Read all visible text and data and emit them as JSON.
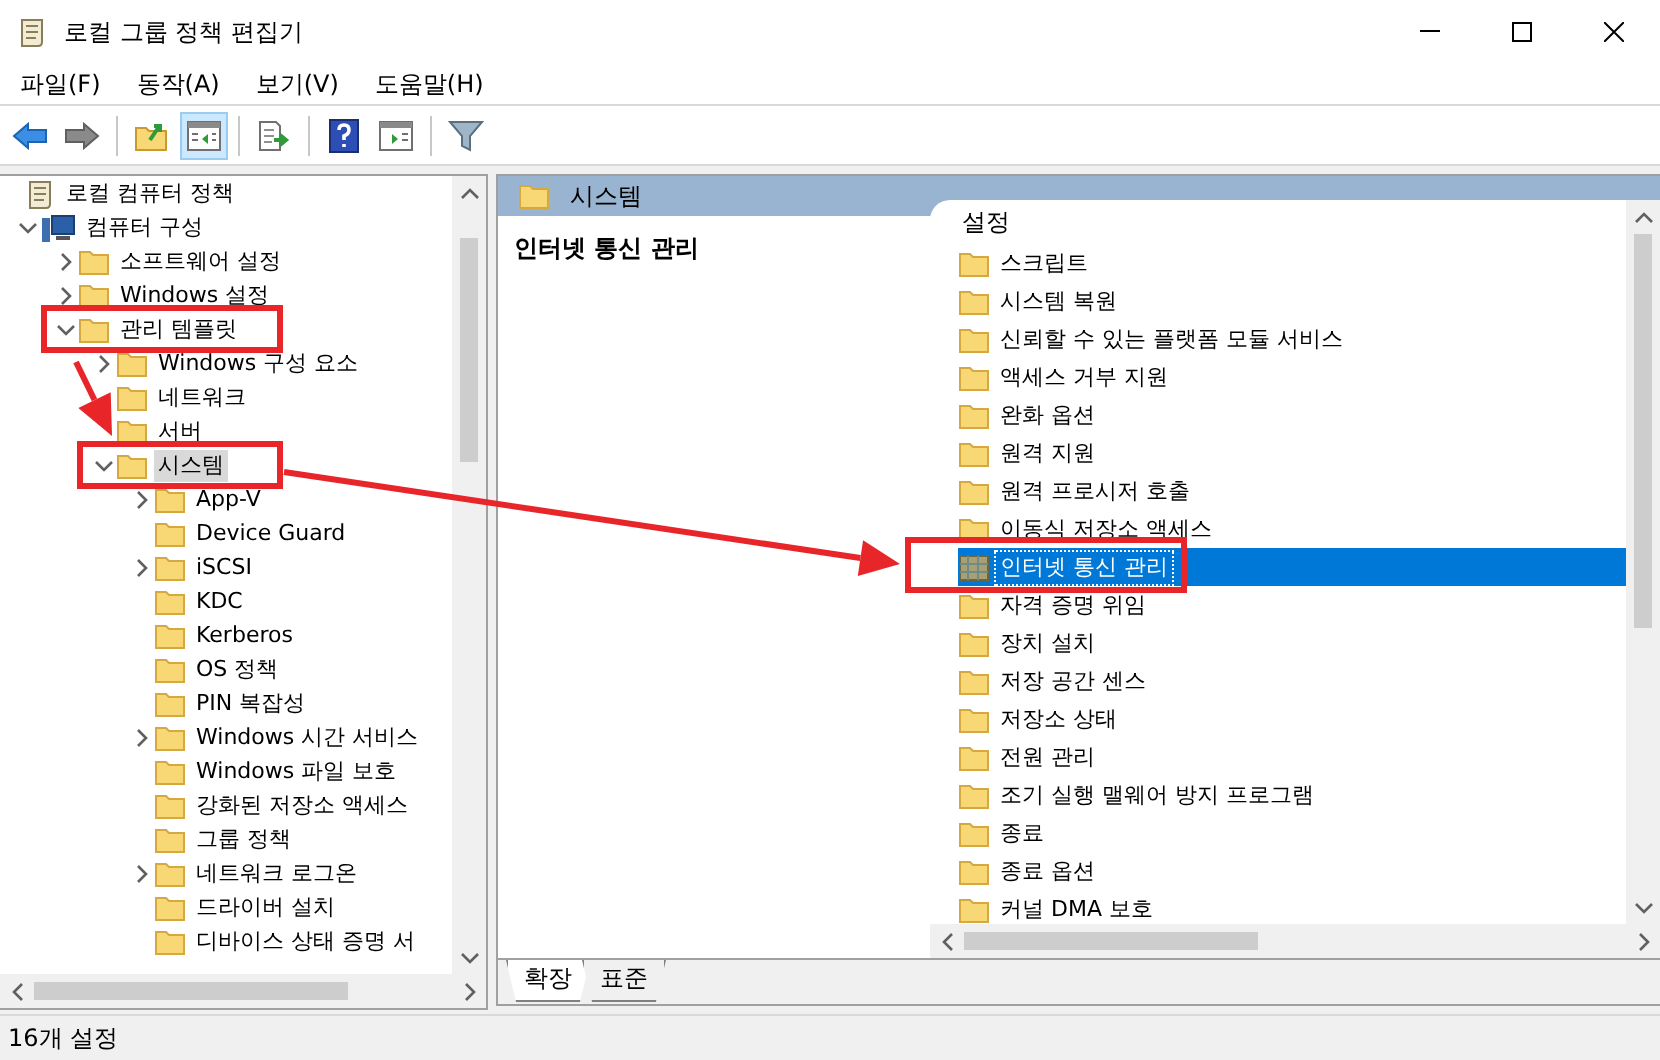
{
  "window": {
    "title": "로컬 그룹 정책 편집기"
  },
  "menu": [
    {
      "label": "파일(F)"
    },
    {
      "label": "동작(A)"
    },
    {
      "label": "보기(V)"
    },
    {
      "label": "도움말(H)"
    }
  ],
  "toolbar": [
    {
      "kind": "back",
      "selected": false
    },
    {
      "kind": "forward",
      "selected": false
    },
    {
      "kind": "sep"
    },
    {
      "kind": "up",
      "selected": false
    },
    {
      "kind": "tree",
      "selected": true
    },
    {
      "kind": "sep"
    },
    {
      "kind": "export",
      "selected": false
    },
    {
      "kind": "sep"
    },
    {
      "kind": "help",
      "selected": false
    },
    {
      "kind": "pane",
      "selected": false
    },
    {
      "kind": "sep"
    },
    {
      "kind": "filter",
      "selected": false
    }
  ],
  "tree": [
    {
      "label": "로컬 컴퓨터 정책",
      "kind": "policy",
      "selected": false,
      "children": [
        {
          "label": "컴퓨터 구성",
          "kind": "computer",
          "expanded": true,
          "selected": false,
          "children": [
            {
              "label": "소프트웨어 설정",
              "kind": "folder",
              "expanded": false,
              "selected": false
            },
            {
              "label": "Windows 설정",
              "kind": "folder",
              "expanded": false,
              "selected": false
            },
            {
              "label": "관리 템플릿",
              "kind": "folder",
              "expanded": true,
              "selected": false,
              "children": [
                {
                  "label": "Windows 구성 요소",
                  "kind": "folder",
                  "expanded": false,
                  "selected": false
                },
                {
                  "label": "네트워크",
                  "kind": "folder",
                  "selected": false
                },
                {
                  "label": "서버",
                  "kind": "folder",
                  "selected": false
                },
                {
                  "label": "시스템",
                  "kind": "folder",
                  "expanded": true,
                  "selected": true,
                  "children": [
                    {
                      "label": "App-V",
                      "kind": "folder",
                      "expanded": false,
                      "selected": false
                    },
                    {
                      "label": "Device Guard",
                      "kind": "folder",
                      "selected": false
                    },
                    {
                      "label": "iSCSI",
                      "kind": "folder",
                      "expanded": false,
                      "selected": false
                    },
                    {
                      "label": "KDC",
                      "kind": "folder",
                      "selected": false
                    },
                    {
                      "label": "Kerberos",
                      "kind": "folder",
                      "selected": false
                    },
                    {
                      "label": "OS 정책",
                      "kind": "folder",
                      "selected": false
                    },
                    {
                      "label": "PIN 복잡성",
                      "kind": "folder",
                      "selected": false
                    },
                    {
                      "label": "Windows 시간 서비스",
                      "kind": "folder",
                      "expanded": false,
                      "selected": false
                    },
                    {
                      "label": "Windows 파일 보호",
                      "kind": "folder",
                      "selected": false
                    },
                    {
                      "label": "강화된 저장소 액세스",
                      "kind": "folder",
                      "selected": false
                    },
                    {
                      "label": "그룹 정책",
                      "kind": "folder",
                      "selected": false
                    },
                    {
                      "label": "네트워크 로그온",
                      "kind": "folder",
                      "expanded": false,
                      "selected": false
                    },
                    {
                      "label": "드라이버 설치",
                      "kind": "folder",
                      "selected": false
                    },
                    {
                      "label": "디바이스 상태 증명 서",
                      "kind": "folder",
                      "selected": false
                    }
                  ]
                }
              ]
            }
          ]
        }
      ]
    }
  ],
  "details": {
    "header": "시스템",
    "description_title": "인터넷 통신 관리",
    "column": "설정",
    "items": [
      {
        "label": "스크립트",
        "kind": "folder",
        "selected": false
      },
      {
        "label": "시스템 복원",
        "kind": "folder",
        "selected": false
      },
      {
        "label": "신뢰할 수 있는 플랫폼 모듈 서비스",
        "kind": "folder",
        "selected": false
      },
      {
        "label": "액세스 거부 지원",
        "kind": "folder",
        "selected": false
      },
      {
        "label": "완화 옵션",
        "kind": "folder",
        "selected": false
      },
      {
        "label": "원격 지원",
        "kind": "folder",
        "selected": false
      },
      {
        "label": "원격 프로시저 호출",
        "kind": "folder",
        "selected": false
      },
      {
        "label": "이동식 저장소 액세스",
        "kind": "folder",
        "selected": false
      },
      {
        "label": "인터넷 통신 관리",
        "kind": "setting",
        "selected": true
      },
      {
        "label": "자격 증명 위임",
        "kind": "folder",
        "selected": false
      },
      {
        "label": "장치 설치",
        "kind": "folder",
        "selected": false
      },
      {
        "label": "저장 공간 센스",
        "kind": "folder",
        "selected": false
      },
      {
        "label": "저장소 상태",
        "kind": "folder",
        "selected": false
      },
      {
        "label": "전원 관리",
        "kind": "folder",
        "selected": false
      },
      {
        "label": "조기 실행 맬웨어 방지 프로그램",
        "kind": "folder",
        "selected": false
      },
      {
        "label": "종료",
        "kind": "folder",
        "selected": false
      },
      {
        "label": "종료 옵션",
        "kind": "folder",
        "selected": false
      },
      {
        "label": "커널 DMA 보호",
        "kind": "folder",
        "selected": false
      }
    ]
  },
  "view_tabs": [
    {
      "label": "확장",
      "selected": true
    },
    {
      "label": "표준",
      "selected": false
    }
  ],
  "status_bar": {
    "text": "16개 설정"
  }
}
